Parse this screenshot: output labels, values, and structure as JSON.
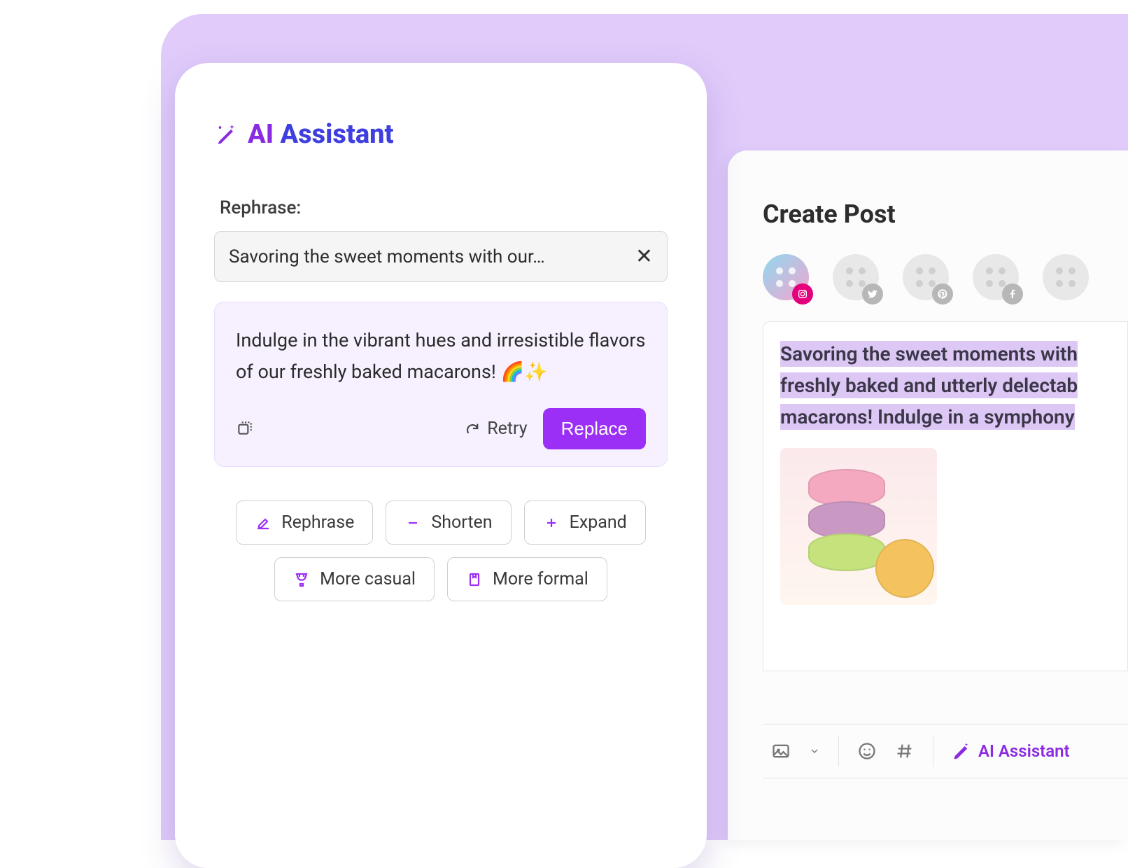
{
  "ai_assistant": {
    "title_a": "AI ",
    "title_b": "Assistant",
    "rephrase_label": "Rephrase:",
    "input_text": "Savoring the sweet moments with our…",
    "result_text": "Indulge in the vibrant hues and irresistible flavors of our freshly baked macarons! 🌈✨",
    "retry_label": "Retry",
    "replace_label": "Replace",
    "pills": {
      "rephrase": "Rephrase",
      "shorten": "Shorten",
      "expand": "Expand",
      "casual": "More casual",
      "formal": "More formal"
    }
  },
  "create_post": {
    "title": "Create Post",
    "accounts": [
      {
        "network": "instagram",
        "active": true
      },
      {
        "network": "twitter",
        "active": false
      },
      {
        "network": "pinterest",
        "active": false
      },
      {
        "network": "facebook",
        "active": false
      },
      {
        "network": "other",
        "active": false
      }
    ],
    "caption_highlighted": "Savoring the sweet moments with freshly baked and utterly delectab macarons! Indulge in a symphony",
    "toolbar": {
      "ai_label": "AI Assistant"
    }
  }
}
